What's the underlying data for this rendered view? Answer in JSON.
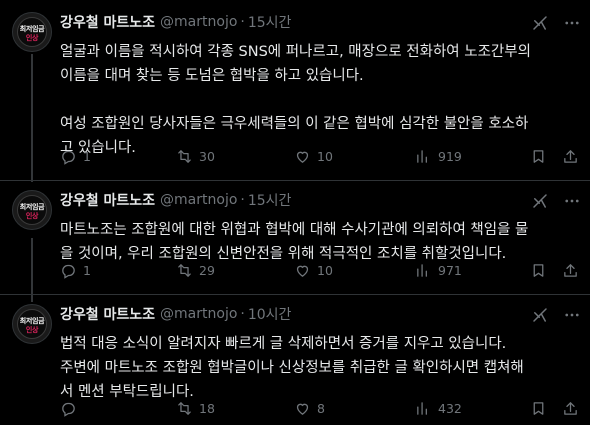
{
  "author": {
    "name": "강우철 마트노조",
    "handle": "@martnojo",
    "separator": "·",
    "avatar_text_line1": "최저임금",
    "avatar_text_line2": "인상"
  },
  "tweets": [
    {
      "time": "15시간",
      "text": "얼굴과 이름을 적시하여 각종 SNS에 퍼나르고, 매장으로 전화하여 노조간부의\n이름을 대며 찾는 등 도넘은 협박을 하고 있습니다.\n\n여성 조합원인 당사자들은 극우세력들의 이 같은 협박에 심각한 불안을 호소하\n고 있습니다.",
      "replies": "1",
      "reposts": "30",
      "likes": "10",
      "views": "919"
    },
    {
      "time": "15시간",
      "text": "마트노조는 조합원에 대한 위협과 협박에 대해 수사기관에 의뢰하여 책임을 물\n을 것이며, 우리 조합원의 신변안전을 위해 적극적인 조치를 취할것입니다.",
      "replies": "1",
      "reposts": "29",
      "likes": "10",
      "views": "971"
    },
    {
      "time": "10시간",
      "text": "법적 대응 소식이 알려지자 빠르게 글 삭제하면서 증거를 지우고 있습니다.\n주변에 마트노조 조합원 협박글이나 신상정보를 취급한 글 확인하시면 캡쳐해\n서 멘션 부탁드립니다.",
      "replies": "",
      "reposts": "18",
      "likes": "8",
      "views": "432"
    }
  ],
  "icons": {
    "grok": "grok-icon",
    "more": "more-icon",
    "reply": "reply-icon",
    "repost": "repost-icon",
    "like": "like-icon",
    "views": "views-icon",
    "bookmark": "bookmark-icon",
    "share": "share-icon"
  }
}
